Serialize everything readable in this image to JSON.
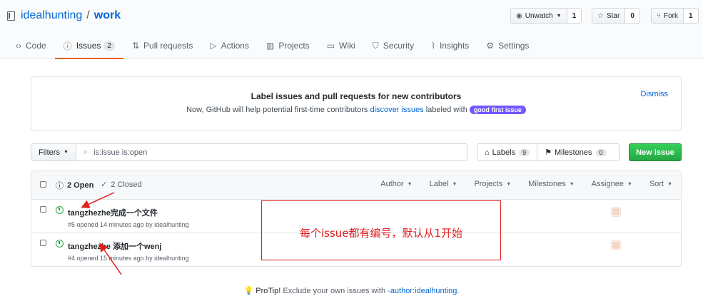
{
  "repo": {
    "owner": "idealhunting",
    "separator": "/",
    "name": "work"
  },
  "repo_buttons": {
    "watch": {
      "label": "Unwatch",
      "count": "1",
      "icon": "eye-icon"
    },
    "star": {
      "label": "Star",
      "count": "0",
      "icon": "star-icon"
    },
    "fork": {
      "label": "Fork",
      "count": "1",
      "icon": "fork-icon"
    }
  },
  "tabs": [
    {
      "label": "Code",
      "icon": "code-icon"
    },
    {
      "label": "Issues",
      "icon": "issue-opened-icon",
      "badge": "2",
      "selected": true
    },
    {
      "label": "Pull requests",
      "icon": "git-pull-request-icon"
    },
    {
      "label": "Actions",
      "icon": "play-icon"
    },
    {
      "label": "Projects",
      "icon": "project-icon"
    },
    {
      "label": "Wiki",
      "icon": "book-icon"
    },
    {
      "label": "Security",
      "icon": "shield-icon"
    },
    {
      "label": "Insights",
      "icon": "graph-icon"
    },
    {
      "label": "Settings",
      "icon": "gear-icon"
    }
  ],
  "banner": {
    "title": "Label issues and pull requests for new contributors",
    "desc_before": "Now, GitHub will help potential first-time contributors",
    "desc_link": "discover issues",
    "desc_after": "labeled with",
    "label": "good first issue",
    "dismiss": "Dismiss"
  },
  "filters": {
    "button": "Filters",
    "search_value": "is:issue is:open"
  },
  "labels_btn": {
    "label": "Labels",
    "count": "9"
  },
  "milestones_btn": {
    "label": "Milestones",
    "count": "0"
  },
  "new_issue": "New issue",
  "list_header": {
    "open": "2 Open",
    "closed": "2 Closed",
    "filters": [
      "Author",
      "Label",
      "Projects",
      "Milestones",
      "Assignee",
      "Sort"
    ]
  },
  "issues": [
    {
      "title": "tangzhezhe完成一个文件",
      "meta": "#5 opened 14 minutes ago by idealhunting"
    },
    {
      "title": "tangzhezhe 添加一个wenj",
      "meta": "#4 opened 15 minutes ago by idealhunting"
    }
  ],
  "annotation": {
    "text": "每个issue都有编号，默认从1开始",
    "color": "#e02020"
  },
  "protip": {
    "label": "ProTip!",
    "text": "Exclude your own issues with",
    "link": "-author:idealhunting",
    "end": "."
  },
  "colors": {
    "accent": "#0366d6",
    "tab_underline": "#e36209",
    "new_issue_green": "#28a745",
    "good_first_issue": "#7057ff",
    "annotation_red": "#e02020"
  }
}
